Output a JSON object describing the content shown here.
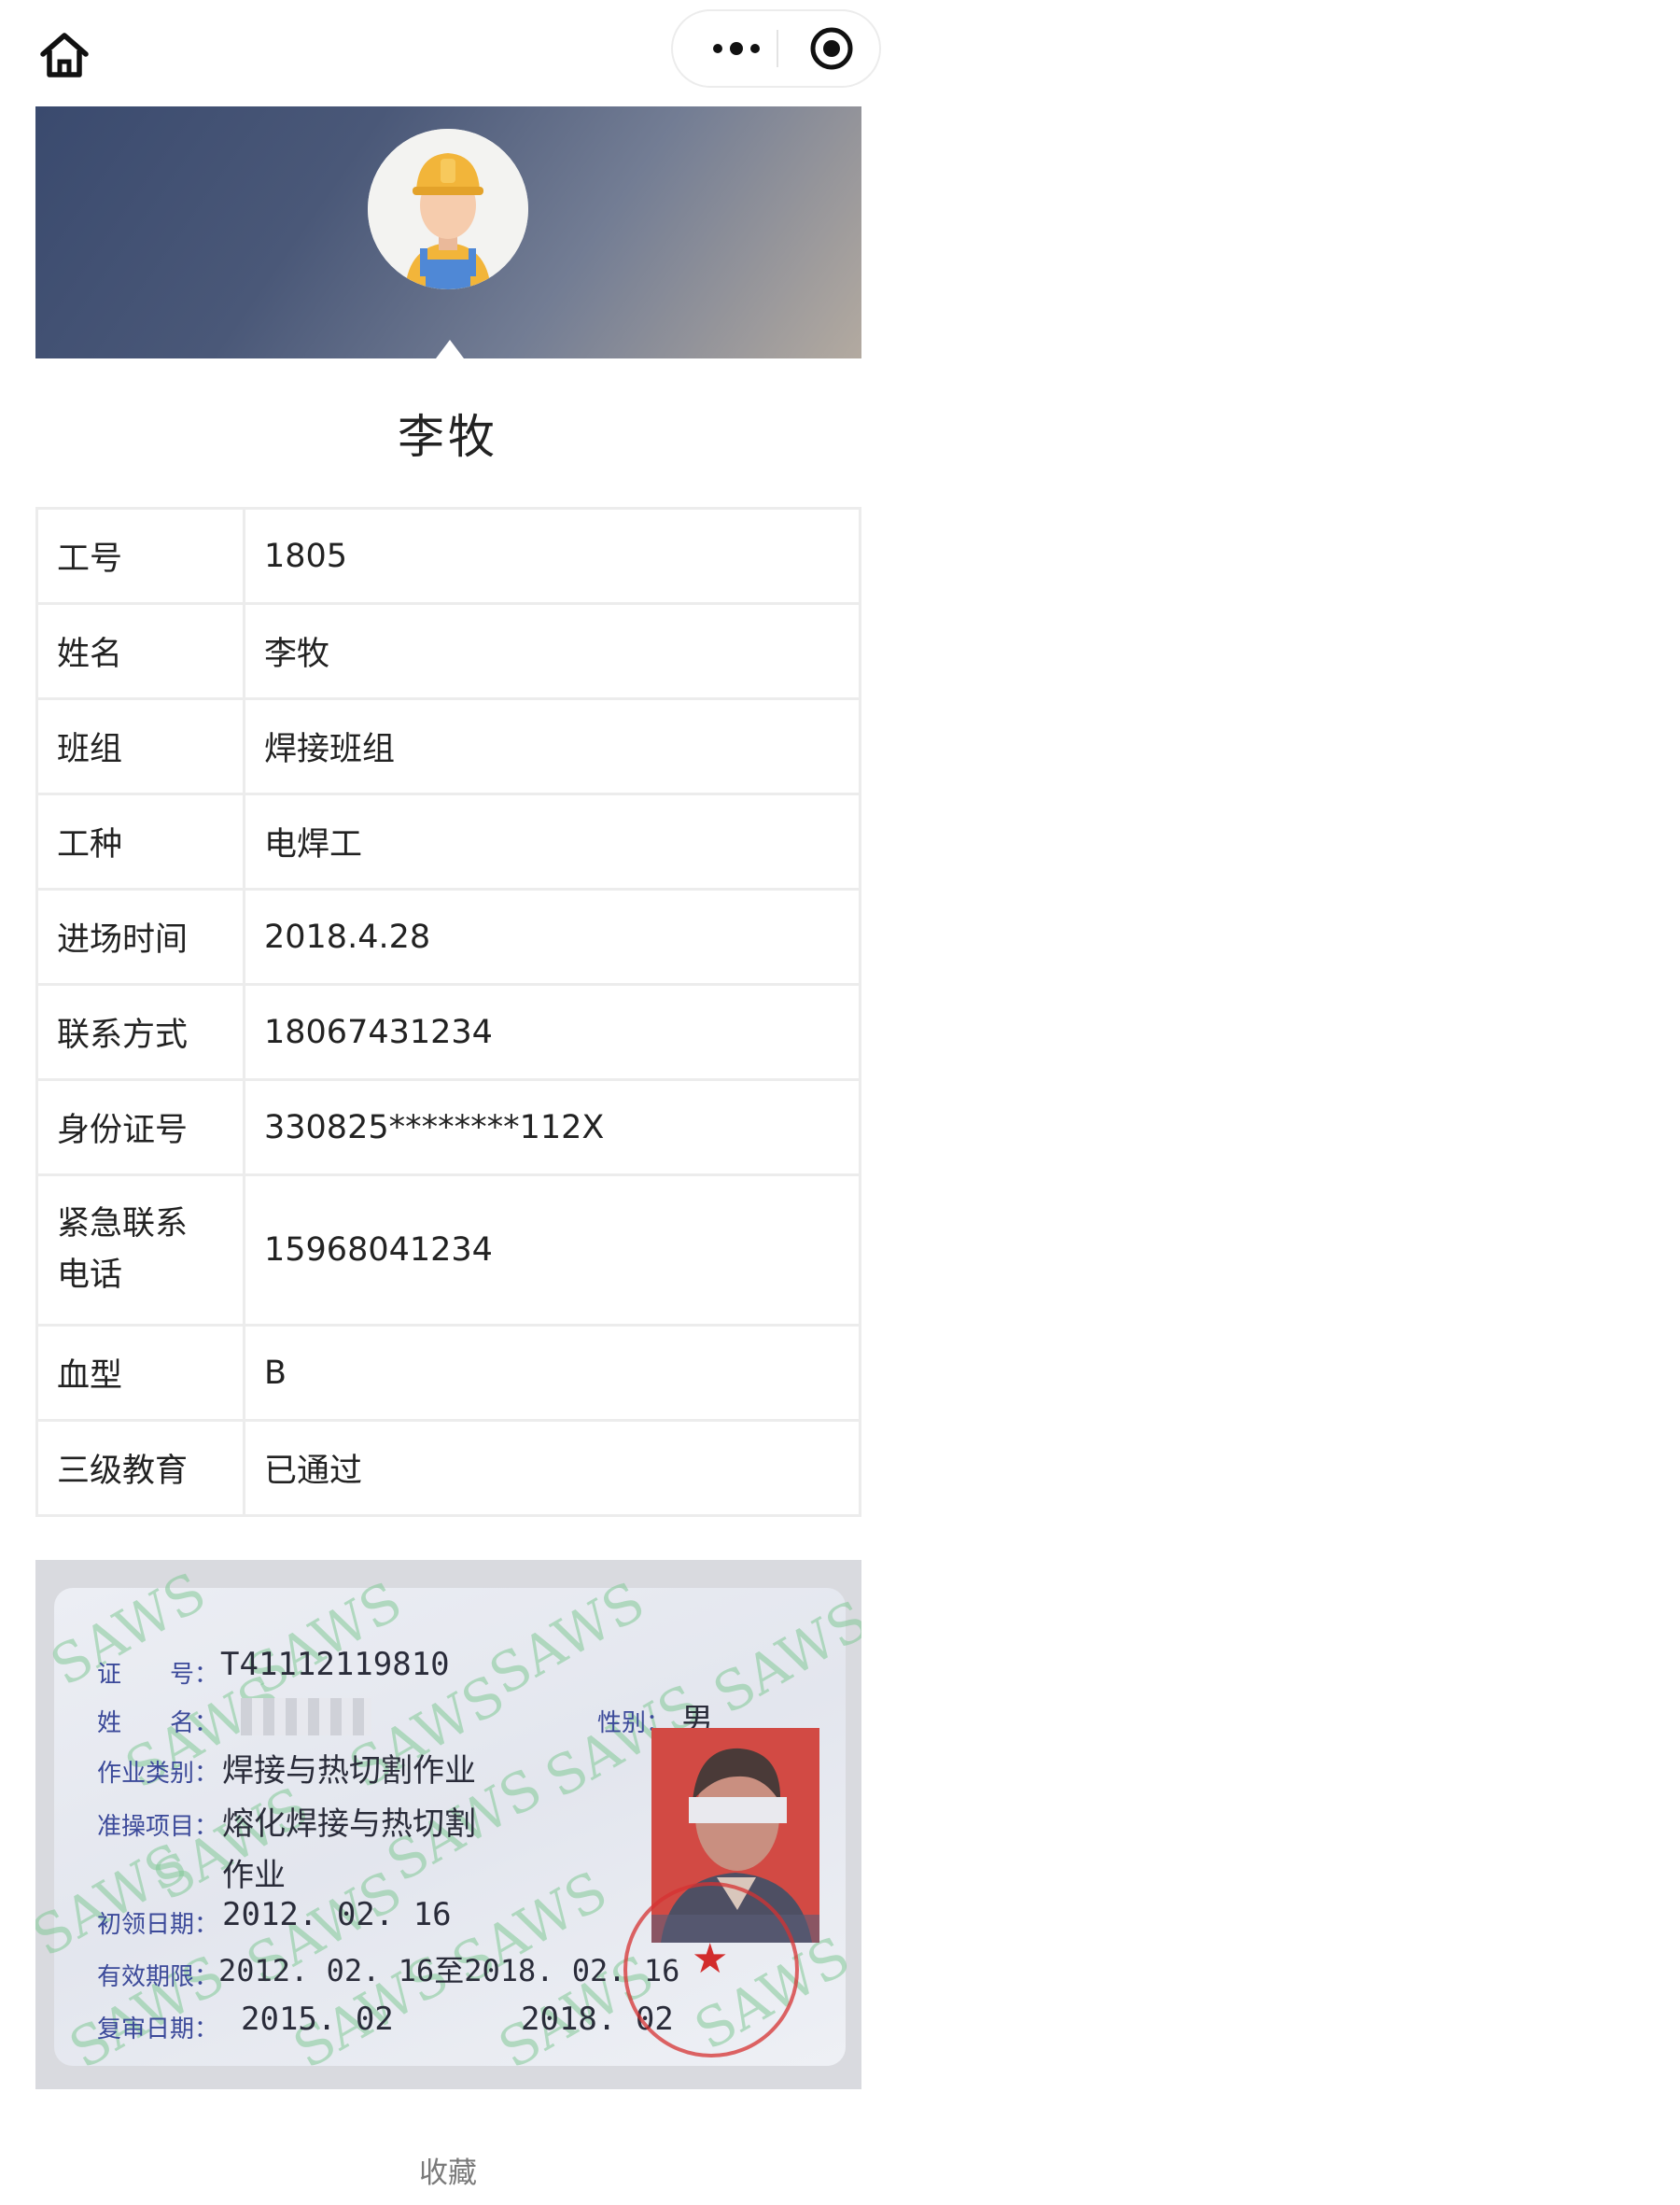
{
  "topbar": {
    "home_icon": "home-icon",
    "more_icon": "more-dots-icon",
    "close_icon": "target-circle-icon"
  },
  "profile": {
    "name": "李牧",
    "avatar_icon": "worker-helmet-avatar"
  },
  "info_rows": [
    {
      "key": "工号",
      "value": "1805"
    },
    {
      "key": "姓名",
      "value": "李牧"
    },
    {
      "key": "班组",
      "value": "焊接班组"
    },
    {
      "key": "工种",
      "value": "电焊工"
    },
    {
      "key": "进场时间",
      "value": "2018.4.28"
    },
    {
      "key": "联系方式",
      "value": "18067431234"
    },
    {
      "key": "身份证号",
      "value": "330825********112X"
    },
    {
      "key": "紧急联系电话",
      "key_line1": "紧急联系",
      "key_line2": "电话",
      "value": "15968041234"
    },
    {
      "key": "血型",
      "value": "B"
    },
    {
      "key": "三级教育",
      "value": "已通过"
    }
  ],
  "certificate": {
    "labels": {
      "cert_no": "证　　号：",
      "name": "姓　　名：",
      "gender": "性别：",
      "category": "作业类别：",
      "item": "准操项目：",
      "first_date": "初领日期：",
      "valid": "有效期限：",
      "review": "复审日期："
    },
    "cert_no": "T41112119810",
    "gender": "男",
    "category": "焊接与热切割作业",
    "item_line1": "熔化焊接与热切割",
    "item_line2": "作业",
    "first_date": "2012. 02. 16",
    "valid": "2012. 02. 16至2018. 02. 16",
    "review_1": "2015. 02",
    "review_2": "2018. 02",
    "watermark": "SAWS"
  },
  "footer": {
    "favorite_label": "收藏"
  }
}
